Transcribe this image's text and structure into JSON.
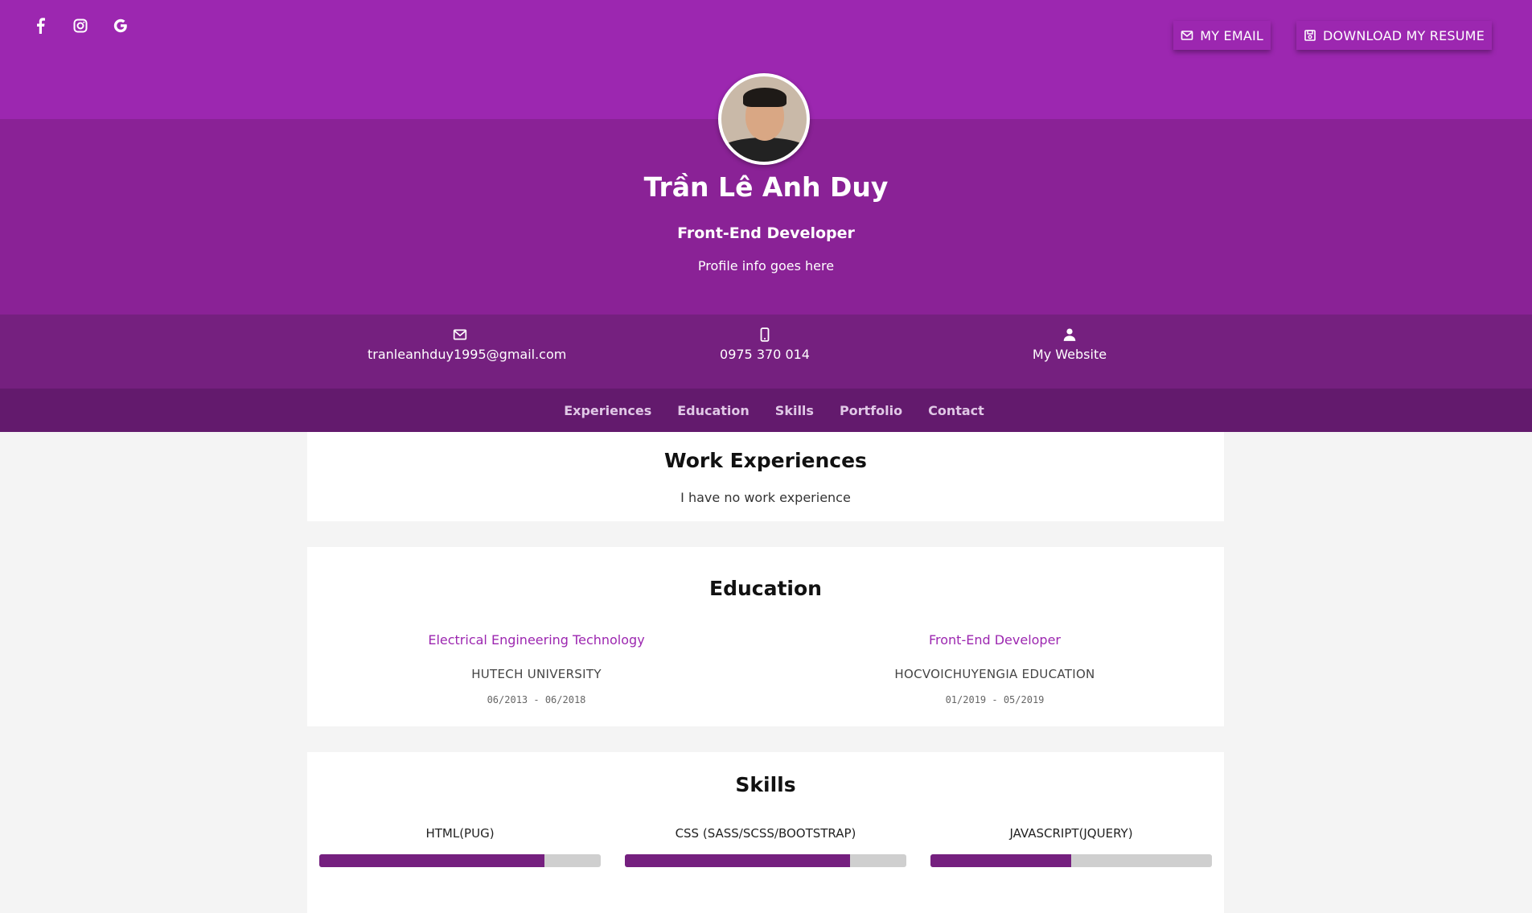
{
  "social": {
    "icons": [
      "facebook-icon",
      "instagram-icon",
      "google-icon"
    ]
  },
  "actions": {
    "email_label": "MY EMAIL",
    "resume_label": "DOWNLOAD MY RESUME"
  },
  "profile": {
    "name": "Trần Lê Anh Duy",
    "role": "Front-End Developer",
    "info": "Profile info goes here"
  },
  "contact": {
    "email": "tranleanhduy1995@gmail.com",
    "phone": "0975 370 014",
    "website": "My Website"
  },
  "nav": {
    "items": [
      "Experiences",
      "Education",
      "Skills",
      "Portfolio",
      "Contact"
    ]
  },
  "experiences": {
    "title": "Work Experiences",
    "text": "I have no work experience"
  },
  "education": {
    "title": "Education",
    "items": [
      {
        "degree": "Electrical Engineering Technology",
        "school": "HUTECH UNIVERSITY",
        "dates": "06/2013 - 06/2018"
      },
      {
        "degree": "Front-End Developer",
        "school": "HOCVOICHUYENGIA EDUCATION",
        "dates": "01/2019 - 05/2019"
      }
    ]
  },
  "skills": {
    "title": "Skills",
    "items": [
      {
        "name": "HTML(PUG)",
        "level": 0.8
      },
      {
        "name": "CSS (SASS/SCSS/BOOTSTRAP)",
        "level": 0.8
      },
      {
        "name": "JAVASCRIPT(JQUERY)",
        "level": 0.5
      }
    ]
  },
  "colors": {
    "primary": "#9c27b0",
    "header": "#8a2296",
    "contact_bar": "#75207f",
    "nav_bar": "#631a6d"
  }
}
